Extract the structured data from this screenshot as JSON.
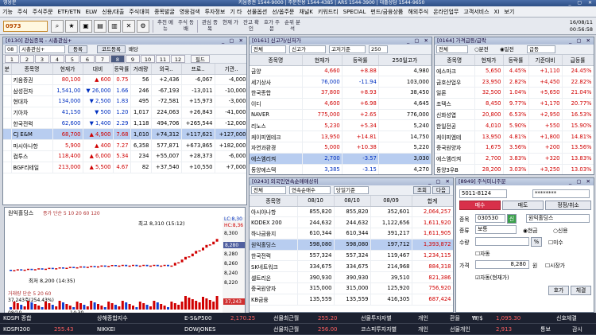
{
  "app": {
    "title": "영웅문",
    "phone": "키움증권 1544-9000 | 주문전용 1544-4385 | ARS 1544-3900 | 대출상담 1544-9650"
  },
  "menu": [
    "기능",
    "주식",
    "주식주문",
    "ETF/ETN",
    "ELW",
    "신용/대출",
    "주식대여",
    "종목발굴",
    "영웅검색",
    "투자정보",
    "기 타",
    "선물옵션",
    "선/옵주문",
    "채널K",
    "키워드티",
    "SPECIAL",
    "펀드/금융상품",
    "해외주식",
    "온라인업무",
    "고객서비스",
    "XI",
    "보기"
  ],
  "toolbar": {
    "code": "0973",
    "buttons": [
      "추천 메뉴",
      "주식 동배",
      "관심 종목",
      "현재 가",
      "잔고 확인",
      "호가 주문",
      "순위 분석"
    ],
    "date": "16/08/11",
    "time": "00:56:58"
  },
  "watch": {
    "title": "[0130] 관심종목 - 시총관심+",
    "group_code": "08",
    "group_name": "시총관심+",
    "register_btn": "등록",
    "code_sort": "코드등록",
    "chk_rate": "배당",
    "tabs": [
      "1",
      "2",
      "3",
      "4",
      "5",
      "6",
      "7",
      "8",
      "9",
      "10",
      "11",
      "12"
    ],
    "selected_tab": "8",
    "extra_btn": "필드",
    "headers": [
      "분",
      "종목명",
      "현재가",
      "대비",
      "등락률",
      "거래량",
      "외국..",
      "프로..",
      "기관.."
    ],
    "rows": [
      [
        "",
        "키움증권",
        "80,100",
        "▲ 600",
        "0.75",
        "56",
        "+2,436",
        "-6,067",
        "-4,000"
      ],
      [
        "",
        "삼성전자",
        "1,541,00",
        "▼ 26,000",
        "1.66",
        "246",
        "-67,193",
        "-13,011",
        "-10,000"
      ],
      [
        "",
        "현대차",
        "134,000",
        "▼ 2,500",
        "1.83",
        "495",
        "-72,581",
        "+15,973",
        "-3,000"
      ],
      [
        "",
        "기아차",
        "41,150",
        "▼ 500",
        "1.20",
        "1,017",
        "224,063",
        "+26,843",
        "-41,000"
      ],
      [
        "",
        "한국전력",
        "62,600",
        "▼ 1,400",
        "2.29",
        "1,118",
        "494,706",
        "+265,544",
        "-12,000"
      ],
      [
        "",
        "CJ E&M",
        "68,700",
        "▲ 4,900",
        "7.68",
        "1,010",
        "+74,312",
        "+117,621",
        "+127,000"
      ],
      [
        "",
        "마시아나항",
        "5,900",
        "▲ 400",
        "7.27",
        "6,358",
        "577,871",
        "+673,865",
        "+182,000"
      ],
      [
        "",
        "컴투스",
        "118,400",
        "▲ 6,000",
        "5.34",
        "234",
        "+55,007",
        "+28,373",
        "-6,000"
      ],
      [
        "",
        "BGF리테일",
        "213,000",
        "▲ 5,500",
        "4.67",
        "82",
        "+37,540",
        "+10,550",
        "+7,000"
      ]
    ],
    "row_dirs": [
      "up",
      "dn",
      "dn",
      "dn",
      "dn",
      "up",
      "up",
      "up",
      "up"
    ]
  },
  "chart": {
    "title": "원익홀딩스",
    "legend": "종가 단순 5 10 20 60 120",
    "high_label": "최고 8,310 (15:12)",
    "low_label": "최저 8,200 (14:35)",
    "vol_label": "거래량 단순 5 20 60",
    "vol_value": "37,243주(254.43%)",
    "date_label": "08/10",
    "time_label": "14:30",
    "prices": [
      "8,300",
      "8,280",
      "8,260",
      "8,240",
      "8,220"
    ],
    "side_tags": [
      "LC:8,30",
      "HC:8,36",
      "8,280",
      "8,250"
    ],
    "vol_side": "37,243"
  },
  "new_high": {
    "title": "[0161] 신고가/신저가",
    "filter_market": "전체",
    "filter_type": "신고가",
    "filter_price": "고저기준",
    "filter_days": "250",
    "headers": [
      "종목명",
      "현재가",
      "등락률",
      "250일고가"
    ],
    "rows": [
      [
        "금양",
        "4,660",
        "+8.88",
        "4,980"
      ],
      [
        "세기상사",
        "76,000",
        "-11.94",
        "103,000"
      ],
      [
        "한국종합",
        "37,800",
        "+8.93",
        "38,450"
      ],
      [
        "이디",
        "4,600",
        "+6.98",
        "4,645"
      ],
      [
        "NAVER",
        "775,000",
        "+2.65",
        "776,000"
      ],
      [
        "리노스",
        "5,230",
        "+5.34",
        "5,240"
      ],
      [
        "케이피엠테크",
        "13,950",
        "+14.81",
        "14,750"
      ],
      [
        "자연과환경",
        "5,000",
        "+10.38",
        "5,220"
      ],
      [
        "에스엠리켜",
        "2,700",
        "-3.57",
        "3,030"
      ],
      [
        "동양에스텍",
        "3,385",
        "-3.15",
        "4,270"
      ]
    ],
    "row_dirs": [
      "up",
      "dn",
      "up",
      "up",
      "up",
      "up",
      "up",
      "up",
      "dn",
      "dn"
    ]
  },
  "surge": {
    "title": "[0164] 가격급등/급락",
    "filter_market": "전체",
    "opt_minute": "분전",
    "opt_day": "일전",
    "filter_type": "급등",
    "headers": [
      "종목명",
      "현재가",
      "등락률",
      "기준대비",
      "급등률"
    ],
    "rows": [
      [
        "에스마크",
        "5,650",
        "4.45%",
        "+1,110",
        "24.45%"
      ],
      [
        "금호산업우",
        "23,950",
        "2.82%",
        "+4,450",
        "22.82%"
      ],
      [
        "일론",
        "32,500",
        "1.04%",
        "+5,650",
        "21.04%"
      ],
      [
        "조텍스",
        "8,450",
        "9.77%",
        "+1,170",
        "20.77%"
      ],
      [
        "신화성엽",
        "20,800",
        "6.53%",
        "+2,950",
        "16.53%"
      ],
      [
        "한일전공",
        "4,010",
        "5.90%",
        "+550",
        "15.90%"
      ],
      [
        "케이피엠테",
        "13,950",
        "4.81%",
        "+1,800",
        "14.81%"
      ],
      [
        "중국원양자",
        "1,675",
        "3.56%",
        "+200",
        "13.56%"
      ],
      [
        "에스엠리켜",
        "2,700",
        "3.83%",
        "+320",
        "13.83%"
      ],
      [
        "동양3우B",
        "28,200",
        "3.03%",
        "+3,250",
        "13.03%"
      ]
    ]
  },
  "foreign": {
    "title": "[0243] 외국인연속순매매상위",
    "filter_market": "전체",
    "filter_type": "연속순매수",
    "filter_base": "당일기준",
    "btn_search": "조회",
    "btn_next": "다음",
    "headers": [
      "종목명",
      "08/10",
      "08/10",
      "08/09",
      "합계"
    ],
    "rows": [
      [
        "아시아나항",
        "855,820",
        "855,820",
        "352,601",
        "2,064,257"
      ],
      [
        "KODEX 200",
        "244,632",
        "244,632",
        "1,122,656",
        "1,611,920"
      ],
      [
        "하나금융지",
        "610,344",
        "610,344",
        "391,217",
        "1,611,905"
      ],
      [
        "원익홀딩스",
        "598,080",
        "598,080",
        "197,712",
        "1,393,872"
      ],
      [
        "한국전력",
        "557,324",
        "557,324",
        "119,467",
        "1,234,115"
      ],
      [
        "SK네트워크",
        "334,675",
        "334,675",
        "214,968",
        "884,318"
      ],
      [
        "셀트리온",
        "390,930",
        "390,930",
        "39,510",
        "821,386"
      ],
      [
        "중국원양자",
        "315,000",
        "315,000",
        "125,920",
        "756,920"
      ],
      [
        "KB금융",
        "135,559",
        "135,559",
        "416,305",
        "687,424"
      ]
    ]
  },
  "order": {
    "title": "[8949] 주식미니주문",
    "account": "5011-8124",
    "password": "********",
    "tabs": [
      "매수",
      "매도",
      "정정/취소"
    ],
    "code": "030530",
    "credit": "신",
    "name": "원익홀딩스",
    "kind_label": "종목",
    "type_label": "종류",
    "type_value": "보통",
    "cash": "현금",
    "credit_opt": "신용",
    "qty_label": "수량",
    "auto": "자동",
    "price_label": "가격",
    "price": "8,280",
    "unit": "원",
    "market_price": "시장가",
    "stop_chk": "미수",
    "auto_chk": "자동(현재가)",
    "quote_btn": "호가",
    "balance_btn": "체결",
    "pct": "%"
  },
  "ticker": {
    "row1": [
      "KOSPI 종합",
      "상해종합지수",
      "E-S&P500",
      "2,170.25",
      "선물최근월",
      "255.20",
      "선물투자자별",
      "개인",
      "환율",
      "₩/$",
      "1,095.30",
      "신호체결"
    ],
    "row2": [
      "KOSPI200",
      "255.43",
      "NIKKEI",
      "DOWJONES",
      "선물차근월",
      "256.00",
      "코스피투자자별",
      "개인",
      "선물개인",
      "2,913",
      "통보",
      "감시"
    ]
  }
}
